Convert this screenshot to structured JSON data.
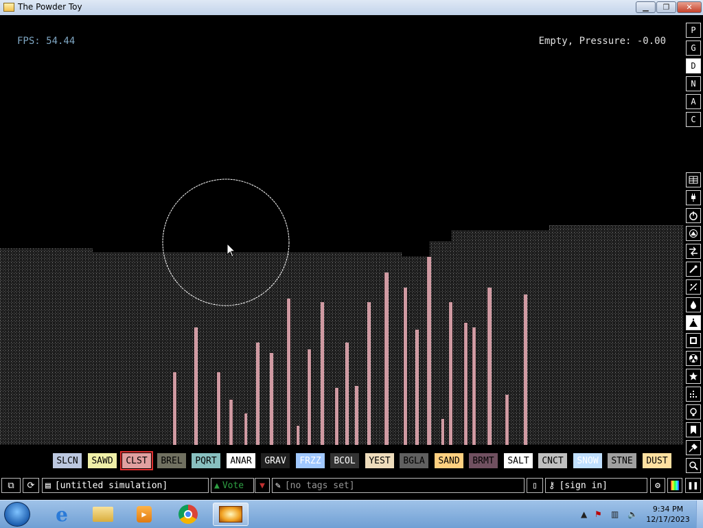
{
  "window": {
    "title": "The Powder Toy"
  },
  "hud": {
    "fps": "FPS: 54.44",
    "status": "Empty, Pressure: -0.00"
  },
  "display_modes": [
    "P",
    "G",
    "D",
    "N",
    "A",
    "C"
  ],
  "active_display_mode": "D",
  "categories": [
    {
      "name": "walls-icon"
    },
    {
      "name": "electronics-icon"
    },
    {
      "name": "powered-icon"
    },
    {
      "name": "sensors-icon"
    },
    {
      "name": "force-icon"
    },
    {
      "name": "explosives-icon"
    },
    {
      "name": "gases-icon"
    },
    {
      "name": "liquids-icon"
    },
    {
      "name": "powders-icon"
    },
    {
      "name": "solids-icon"
    },
    {
      "name": "radioactive-icon"
    },
    {
      "name": "special-icon"
    },
    {
      "name": "game-of-life-icon"
    },
    {
      "name": "tools-icon"
    },
    {
      "name": "favorites-icon"
    },
    {
      "name": "decoration-icon"
    },
    {
      "name": "search-icon"
    }
  ],
  "active_category": "powders-icon",
  "elements": [
    {
      "label": "SLCN",
      "bg": "#bcc8e0",
      "fg": "#000000"
    },
    {
      "label": "SAWD",
      "bg": "#f0f0a8",
      "fg": "#000000"
    },
    {
      "label": "CLST",
      "bg": "#e0a0a0",
      "fg": "#000000",
      "selected": true
    },
    {
      "label": "BREL",
      "bg": "#707060",
      "fg": "#000000"
    },
    {
      "label": "PQRT",
      "bg": "#88c0c0",
      "fg": "#000000"
    },
    {
      "label": "ANAR",
      "bg": "#ffffff",
      "fg": "#000000"
    },
    {
      "label": "GRAV",
      "bg": "#202020",
      "fg": "#ffffff"
    },
    {
      "label": "FRZZ",
      "bg": "#a0c8ff",
      "fg": "#ffffff"
    },
    {
      "label": "BCOL",
      "bg": "#333333",
      "fg": "#ffffff"
    },
    {
      "label": "YEST",
      "bg": "#eedcbc",
      "fg": "#000000"
    },
    {
      "label": "BGLA",
      "bg": "#606060",
      "fg": "#000000"
    },
    {
      "label": "SAND",
      "bg": "#ffd080",
      "fg": "#000000"
    },
    {
      "label": "BRMT",
      "bg": "#705060",
      "fg": "#000000"
    },
    {
      "label": "SALT",
      "bg": "#ffffff",
      "fg": "#000000"
    },
    {
      "label": "CNCT",
      "bg": "#c0c0c0",
      "fg": "#000000"
    },
    {
      "label": "SNOW",
      "bg": "#c0e0ff",
      "fg": "#ffffff"
    },
    {
      "label": "STNE",
      "bg": "#a0a0a0",
      "fg": "#000000"
    },
    {
      "label": "DUST",
      "bg": "#ffe0a0",
      "fg": "#000000"
    }
  ],
  "bottom_bar": {
    "save_title": "[untitled simulation]",
    "vote": "Vote",
    "tags": "[no tags set]",
    "sign_in": "[sign in]"
  },
  "taskbar": {
    "time": "9:34 PM",
    "date": "12/17/2023",
    "apps": [
      "windows-start-icon",
      "internet-explorer-icon",
      "file-explorer-icon",
      "media-player-icon",
      "chrome-icon",
      "powder-toy-icon"
    ]
  }
}
